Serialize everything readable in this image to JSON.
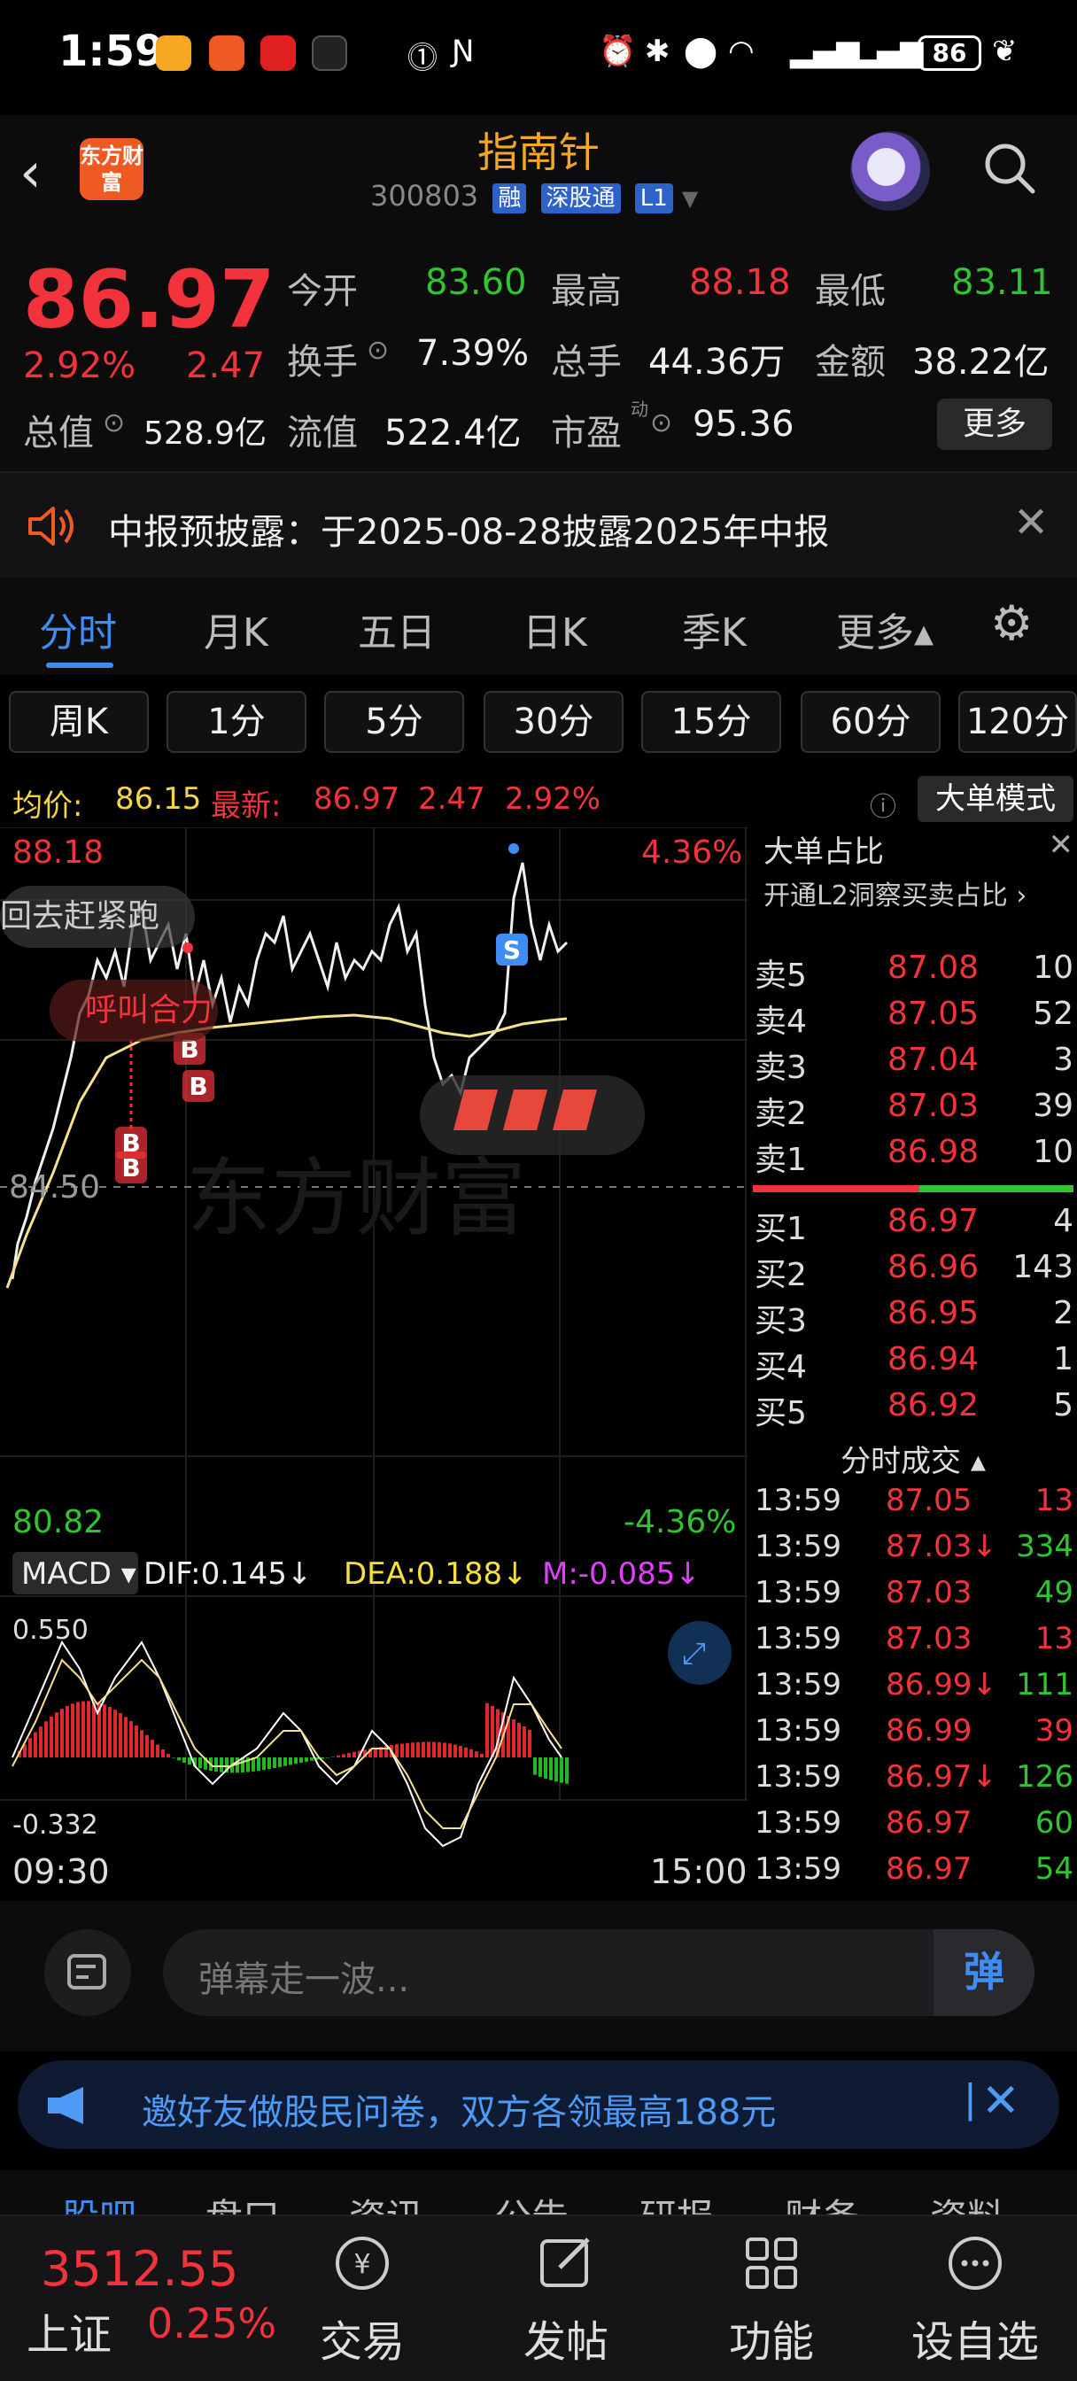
{
  "status_bar": {
    "time": "1:59",
    "battery": "86"
  },
  "header": {
    "logo_text": "东方财富",
    "title": "指南针",
    "code": "300803",
    "tags": [
      "融",
      "深股通",
      "L1"
    ]
  },
  "quote": {
    "price": "86.97",
    "change_pct": "2.92%",
    "change": "2.47",
    "open_label": "今开",
    "open": "83.60",
    "high_label": "最高",
    "high": "88.18",
    "low_label": "最低",
    "low": "83.11",
    "turnover_label": "换手",
    "turnover": "7.39%",
    "volume_label": "总手",
    "volume": "44.36万",
    "amount_label": "金额",
    "amount": "38.22亿",
    "mktcap_label": "总值",
    "mktcap": "528.9亿",
    "float_label": "流值",
    "float": "522.4亿",
    "pe_label": "市盈",
    "pe_sup": "动",
    "pe": "95.36",
    "more_button": "更多"
  },
  "notice": {
    "text": "中报预披露：于2025-08-28披露2025年中报"
  },
  "tabs": [
    "分时",
    "月K",
    "五日",
    "日K",
    "季K",
    "更多▴"
  ],
  "periods": [
    "周K",
    "1分",
    "5分",
    "30分",
    "15分",
    "60分",
    "120分"
  ],
  "avg_row": {
    "avg_label": "均价:",
    "avg": "86.15",
    "latest_label": "最新:",
    "latest": "86.97",
    "chg": "2.47",
    "pct": "2.92%",
    "big_order_button": "大单模式"
  },
  "chart": {
    "top_price": "88.18",
    "top_pct": "4.36%",
    "mid_price": "84.50",
    "bottom_price": "80.82",
    "bottom_pct": "-4.36%",
    "bubble1": "回去赶紧跑",
    "bubble2": "呼叫合力",
    "watermark": "东方财富",
    "macd_label": "MACD",
    "dif": "DIF:0.145↓",
    "dea": "DEA:0.188↓",
    "m": "M:-0.085↓",
    "macd_top": "0.550",
    "macd_bottom": "-0.332",
    "time_start": "09:30",
    "time_end": "15:00"
  },
  "orderbook": {
    "header_title": "大单占比",
    "l2_link": "开通L2洞察买卖占比 ›",
    "asks": [
      {
        "label": "卖5",
        "price": "87.08",
        "vol": "10"
      },
      {
        "label": "卖4",
        "price": "87.05",
        "vol": "52"
      },
      {
        "label": "卖3",
        "price": "87.04",
        "vol": "3"
      },
      {
        "label": "卖2",
        "price": "87.03",
        "vol": "39"
      },
      {
        "label": "卖1",
        "price": "86.98",
        "vol": "10"
      }
    ],
    "bids": [
      {
        "label": "买1",
        "price": "86.97",
        "vol": "4"
      },
      {
        "label": "买2",
        "price": "86.96",
        "vol": "143"
      },
      {
        "label": "买3",
        "price": "86.95",
        "vol": "2"
      },
      {
        "label": "买4",
        "price": "86.94",
        "vol": "1"
      },
      {
        "label": "买5",
        "price": "86.92",
        "vol": "5"
      }
    ],
    "trades_title": "分时成交 ▴",
    "trades": [
      {
        "t": "13:59",
        "p": "87.05",
        "v": "13"
      },
      {
        "t": "13:59",
        "p": "87.03↓",
        "v": "334"
      },
      {
        "t": "13:59",
        "p": "87.03",
        "v": "49"
      },
      {
        "t": "13:59",
        "p": "87.03",
        "v": "13"
      },
      {
        "t": "13:59",
        "p": "86.99↓",
        "v": "111"
      },
      {
        "t": "13:59",
        "p": "86.99",
        "v": "39"
      },
      {
        "t": "13:59",
        "p": "86.97↓",
        "v": "126"
      },
      {
        "t": "13:59",
        "p": "86.97",
        "v": "60"
      },
      {
        "t": "13:59",
        "p": "86.97",
        "v": "54"
      }
    ]
  },
  "comment": {
    "placeholder": "弹幕走一波...",
    "send": "弹"
  },
  "invite": {
    "text": "邀好友做股民问卷，双方各领最高188元"
  },
  "subtabs": [
    "股吧",
    "盘口",
    "资讯",
    "公告",
    "研报",
    "财务",
    "资料"
  ],
  "bottom_nav": {
    "index_value": "3512.55",
    "index_name": "上证",
    "index_pct": "0.25%",
    "items": [
      "交易",
      "发帖",
      "功能",
      "设自选"
    ]
  },
  "colors": {
    "up": "#f2333b",
    "down": "#2ec52e",
    "accent": "#3d8df5",
    "title": "#f5a623"
  }
}
